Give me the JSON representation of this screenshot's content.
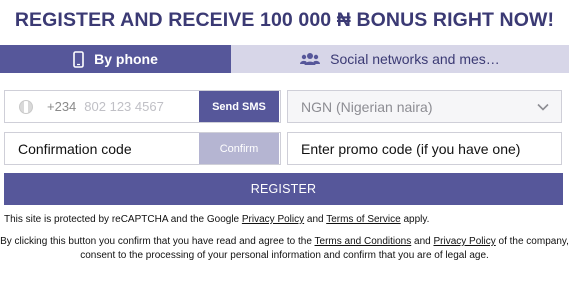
{
  "headline": "REGISTER AND RECEIVE 100 000 ₦ BONUS RIGHT NOW!",
  "tabs": {
    "phone": {
      "label": "By phone",
      "icon": "smartphone-icon",
      "active": true
    },
    "social": {
      "label": "Social networks and mes…",
      "icon": "users-icon",
      "active": false
    }
  },
  "form": {
    "phone": {
      "country_code": "+234",
      "placeholder": "802 123 4567",
      "value": ""
    },
    "send_sms_label": "Send SMS",
    "currency": {
      "selected": "NGN (Nigerian naira)"
    },
    "confirmation": {
      "placeholder": "Confirmation code",
      "value": ""
    },
    "confirm_label": "Confirm",
    "promo": {
      "placeholder": "Enter promo code (if you have one)",
      "value": ""
    },
    "register_label": "REGISTER"
  },
  "legal": {
    "recaptcha": {
      "prefix": "This site is protected by reCAPTCHA and the Google ",
      "privacy_link": "Privacy Policy",
      "and": " and ",
      "terms_link": "Terms of Service",
      "suffix": " apply."
    },
    "agree": {
      "prefix": "By clicking this button you confirm that you have read and agree to the ",
      "terms_link": "Terms and Conditions",
      "and": " and ",
      "privacy_link": "Privacy Policy",
      "suffix": " of the company,",
      "line2": "consent to the processing of your personal information and confirm that you are of legal age."
    }
  },
  "colors": {
    "accent": "#56579a",
    "headline": "#3b3a74",
    "tab_inactive": "#d7d6e8",
    "confirm_disabled": "#b5b5d2"
  }
}
